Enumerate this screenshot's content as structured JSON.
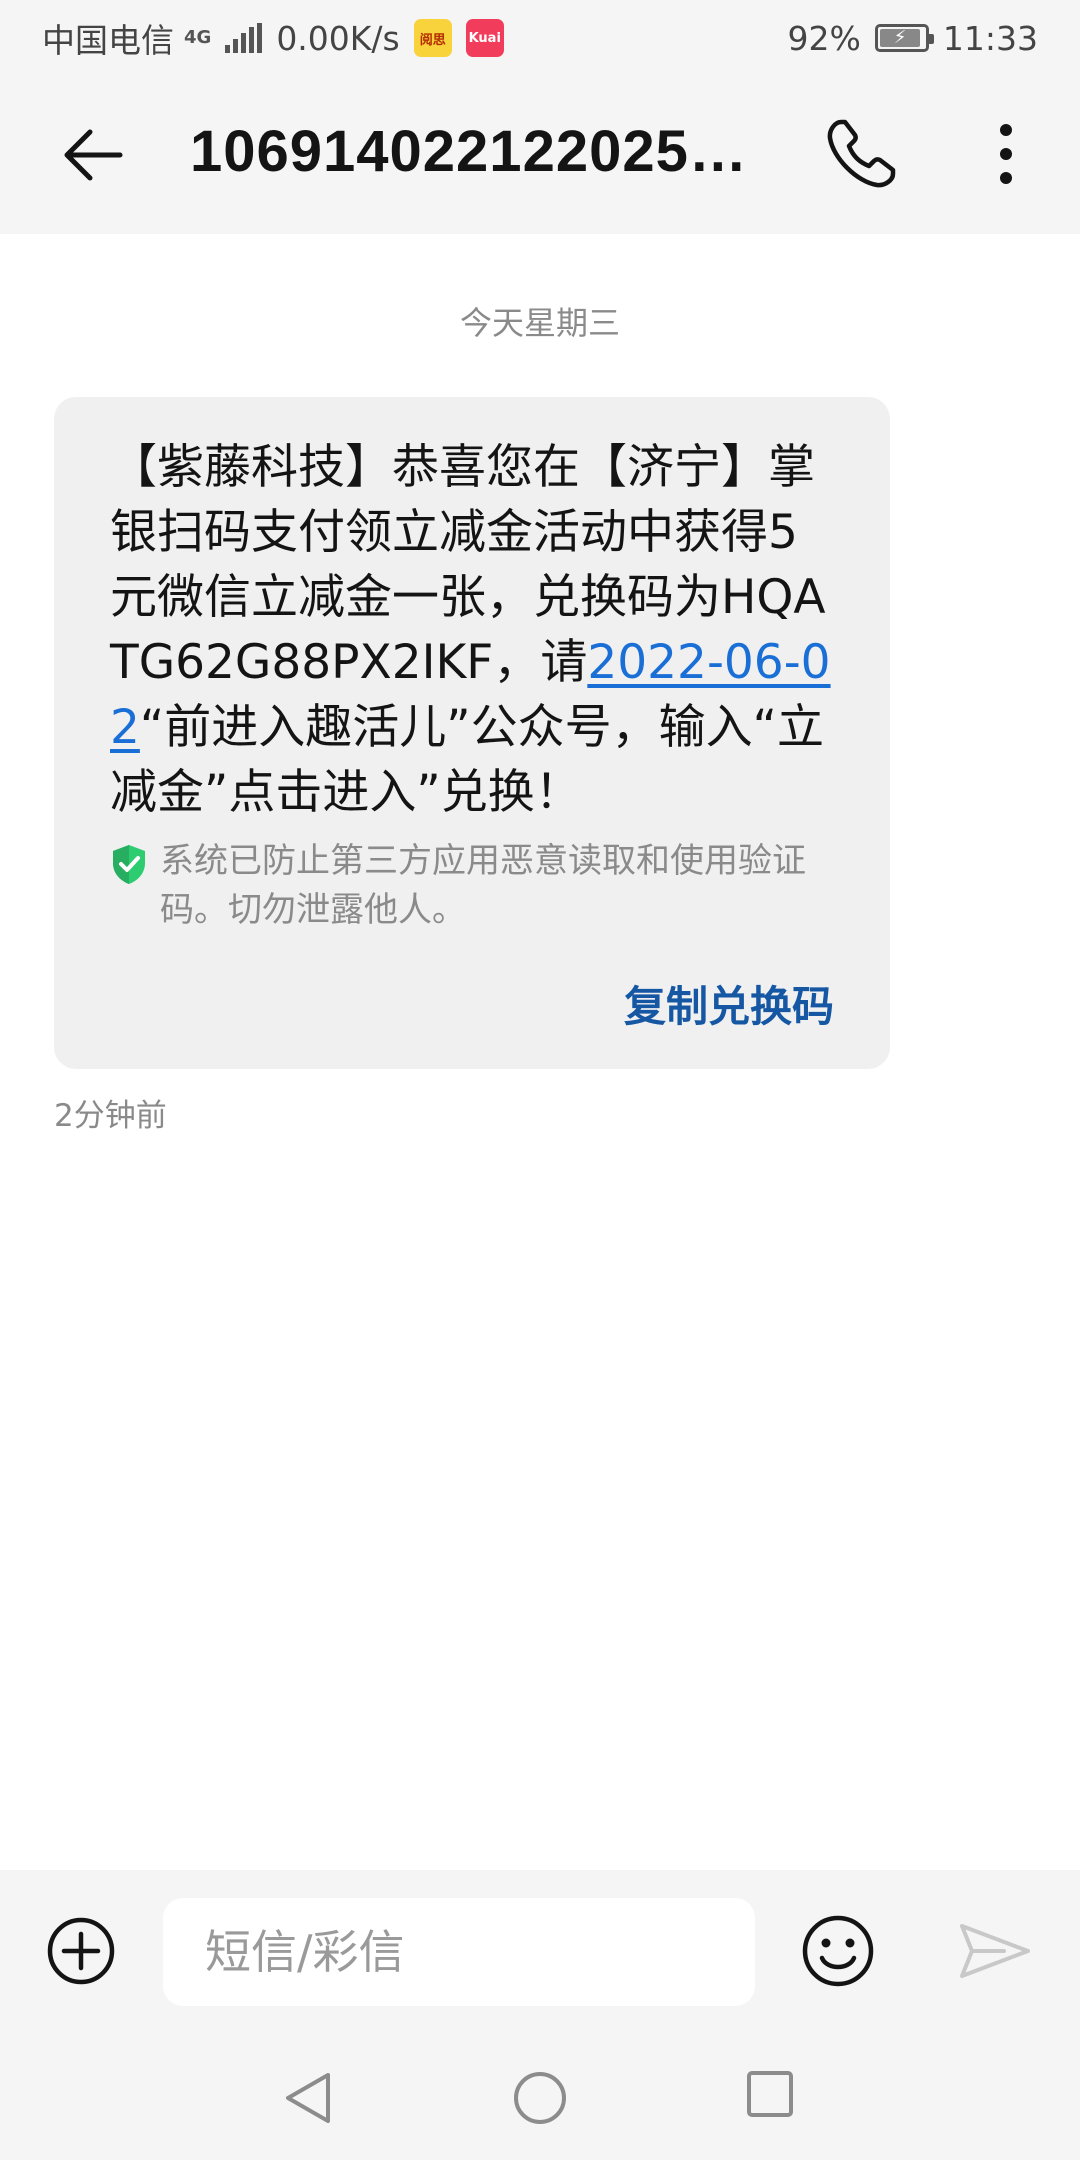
{
  "status_bar": {
    "carrier": "中国电信",
    "network_type": "4G",
    "speed": "0.00K/s",
    "app_badge_1": "阅思",
    "app_badge_2": "Kuai",
    "battery": "92%",
    "time": "11:33"
  },
  "header": {
    "title": "106914022122025…"
  },
  "conversation": {
    "date_separator": "今天星期三",
    "message": {
      "text_before_link": "【紫藤科技】恭喜您在【济宁】掌银扫码支付领立减金活动中获得5元微信立减金一张，兑换码为HQATG62G88PX2IKF，请",
      "link": "2022-06-02",
      "text_after_link": "“前进入趣活儿”公众号，输入“立减金”点击进入”兑换！",
      "security_notice": "系统已防止第三方应用恶意读取和使用验证码。切勿泄露他人。",
      "action_label": "复制兑换码",
      "time": "2分钟前"
    }
  },
  "input_bar": {
    "placeholder": "短信/彩信"
  },
  "colors": {
    "link": "#1a6fd6",
    "action": "#1557a3",
    "shield": "#2ecc71"
  }
}
